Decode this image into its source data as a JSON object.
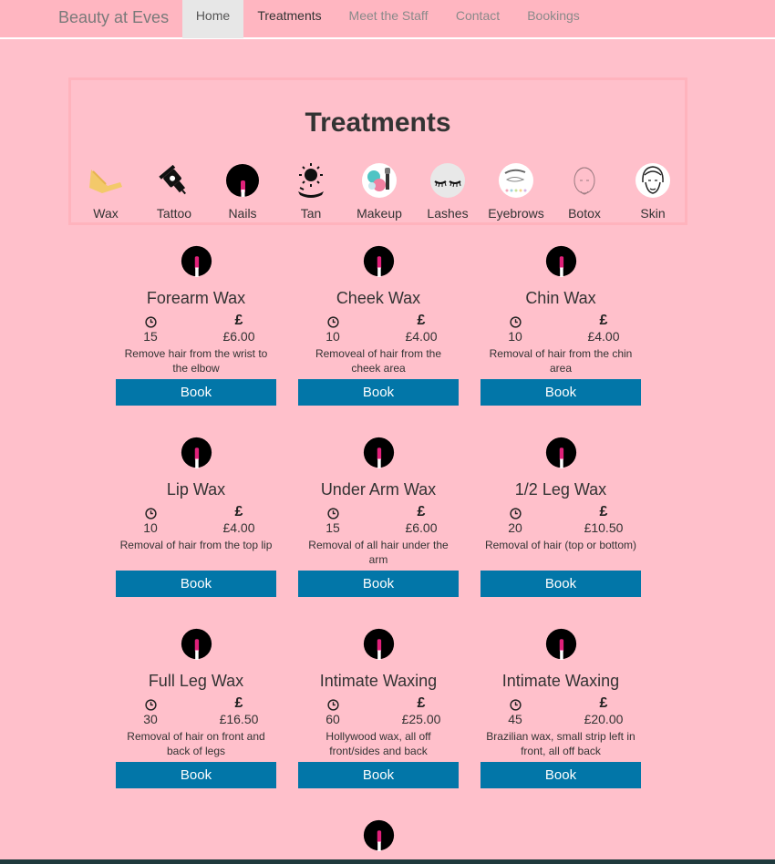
{
  "nav": {
    "brand": "Beauty at Eves",
    "items": [
      "Home",
      "Treatments",
      "Meet the Staff",
      "Contact",
      "Bookings"
    ]
  },
  "treatments_panel": {
    "title": "Treatments",
    "categories": [
      {
        "label": "Wax",
        "icon": "wax-strip-icon"
      },
      {
        "label": "Tattoo",
        "icon": "tattoo-machine-icon"
      },
      {
        "label": "Nails",
        "icon": "nail-icon"
      },
      {
        "label": "Tan",
        "icon": "sun-tan-icon"
      },
      {
        "label": "Makeup",
        "icon": "makeup-palette-icon"
      },
      {
        "label": "Lashes",
        "icon": "eyelash-icon"
      },
      {
        "label": "Eyebrows",
        "icon": "eyebrow-icon"
      },
      {
        "label": "Botox",
        "icon": "face-outline-icon"
      },
      {
        "label": "Skin",
        "icon": "face-portrait-icon"
      }
    ]
  },
  "cards": [
    {
      "title": "Forearm Wax",
      "time": "15",
      "price": "£6.00",
      "description": "Remove hair from the wrist to the elbow",
      "button": "Book"
    },
    {
      "title": "Cheek Wax",
      "time": "10",
      "price": "£4.00",
      "description": "Removeal of hair from the cheek area",
      "button": "Book"
    },
    {
      "title": "Chin Wax",
      "time": "10",
      "price": "£4.00",
      "description": "Removal of hair from the chin area",
      "button": "Book"
    },
    {
      "title": "Lip Wax",
      "time": "10",
      "price": "£4.00",
      "description": "Removal of hair from the top lip",
      "button": "Book"
    },
    {
      "title": "Under Arm Wax",
      "time": "15",
      "price": "£6.00",
      "description": "Removal of all hair under the arm",
      "button": "Book"
    },
    {
      "title": "1/2 Leg Wax",
      "time": "20",
      "price": "£10.50",
      "description": "Removal of hair (top or bottom)",
      "button": "Book"
    },
    {
      "title": "Full Leg Wax",
      "time": "30",
      "price": "£16.50",
      "description": "Removal of hair on front and back of legs",
      "button": "Book"
    },
    {
      "title": "Intimate Waxing",
      "time": "60",
      "price": "£25.00",
      "description": "Hollywood wax, all off front/sides and back",
      "button": "Book"
    },
    {
      "title": "Intimate Waxing",
      "time": "45",
      "price": "£20.00",
      "description": "Brazilian wax, small strip left in front, all off back",
      "button": "Book"
    }
  ],
  "pound_symbol": "£",
  "colors": {
    "background": "#ffc0cb",
    "navbar": "#ffb6c1",
    "book_button": "#0276a8",
    "nail_polish": "#e0217a"
  }
}
